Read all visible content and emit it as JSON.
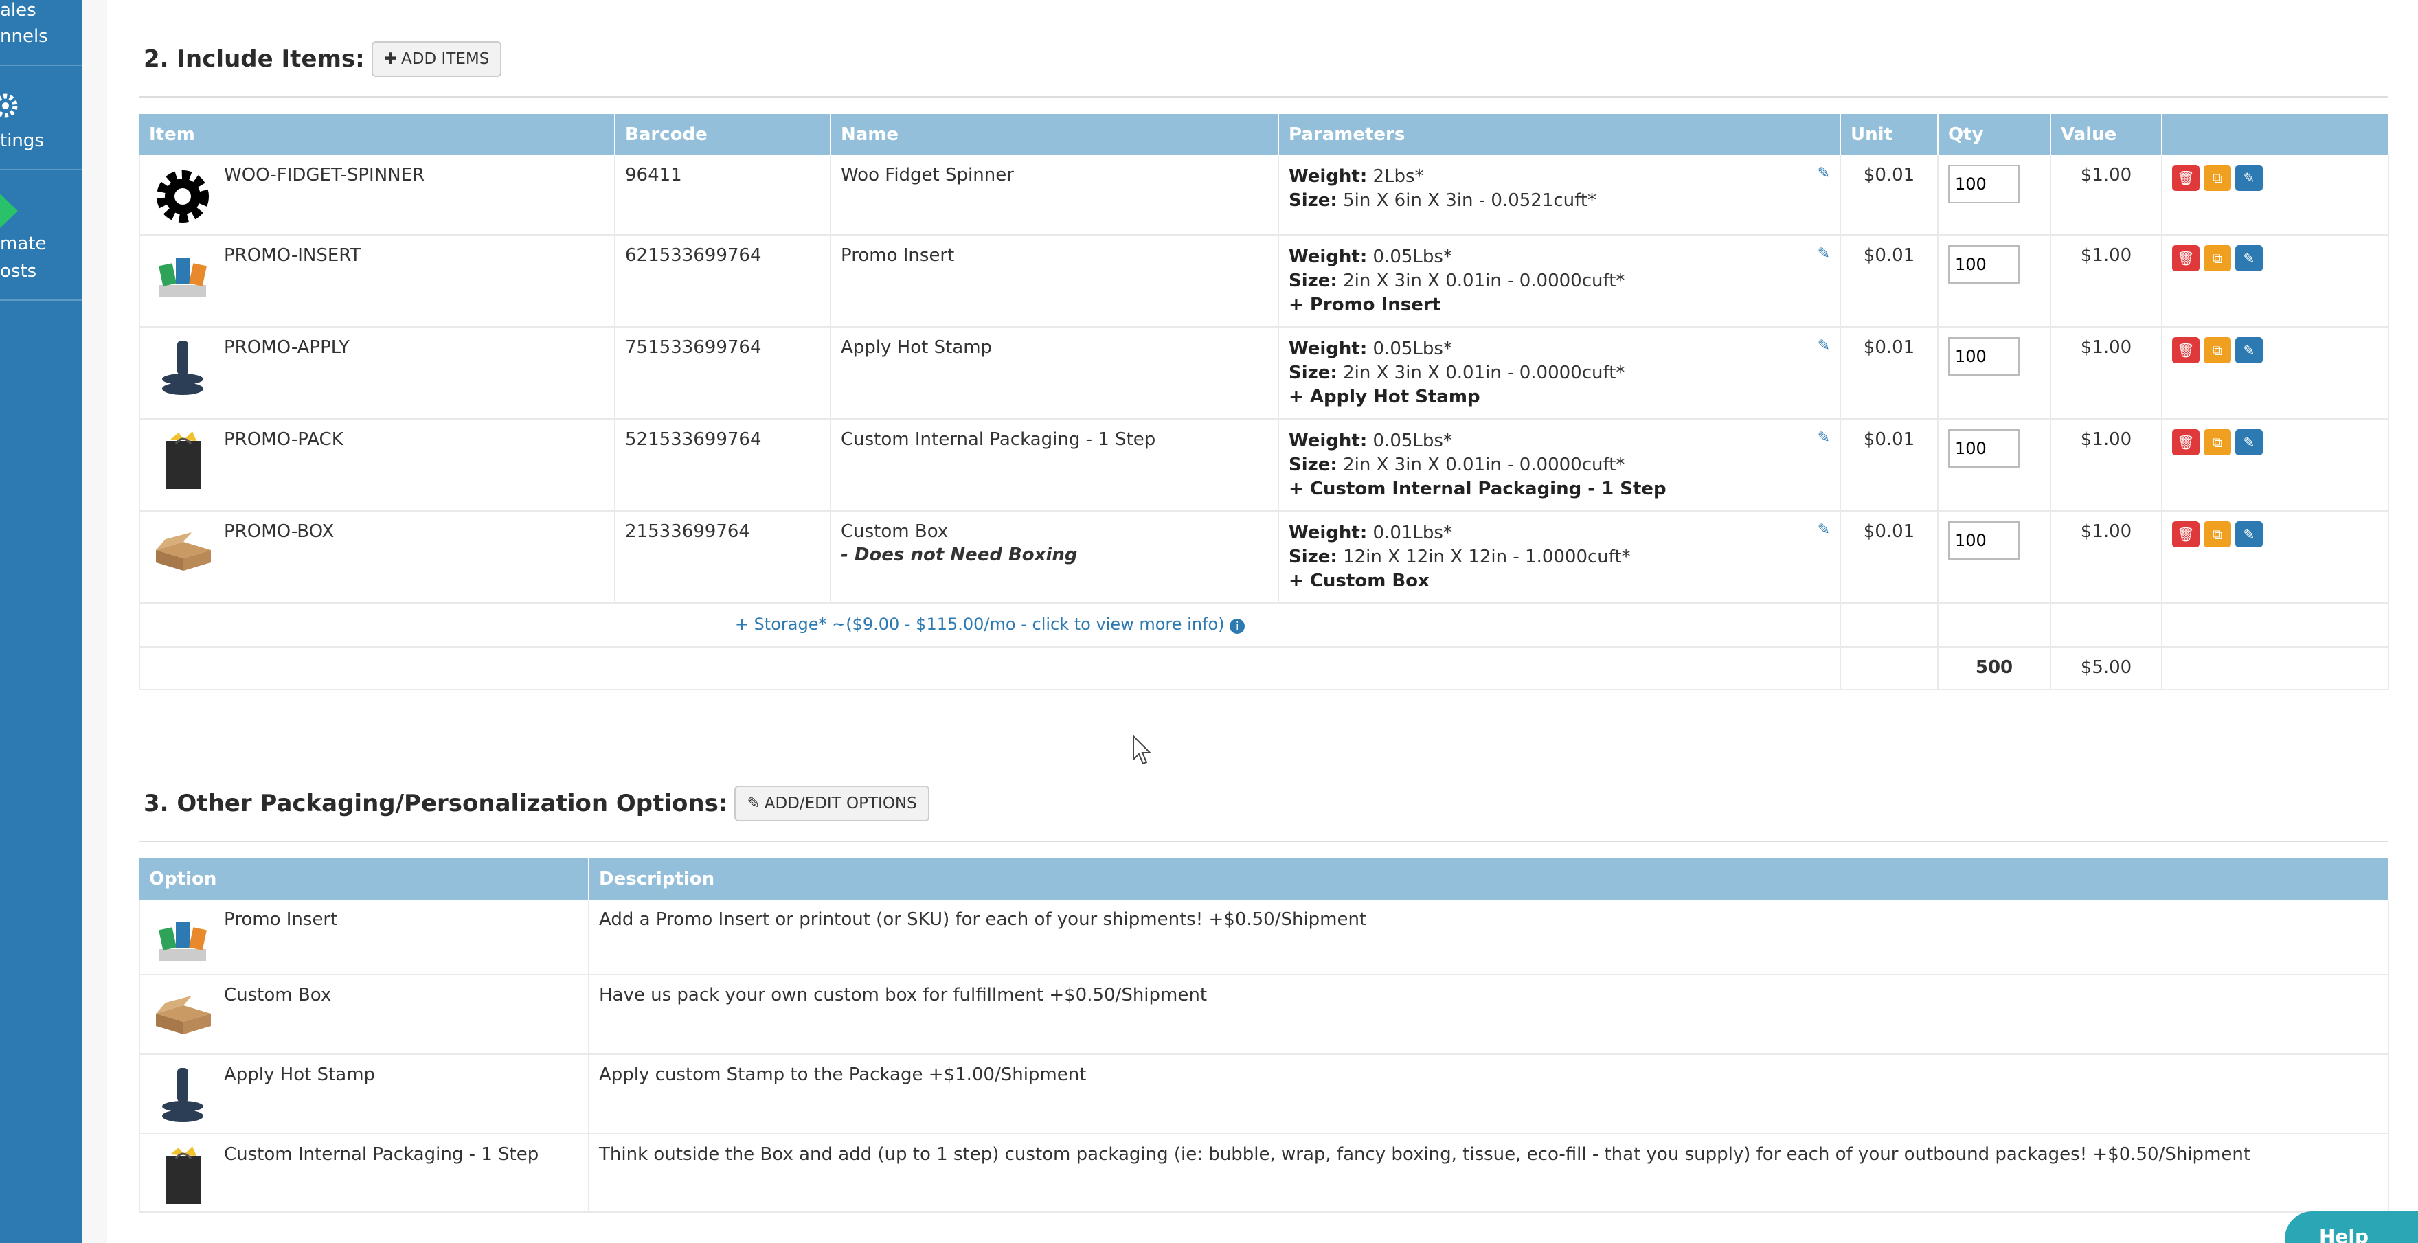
{
  "sidebar": {
    "items": [
      {
        "label": "ales"
      },
      {
        "label": "nnels"
      },
      {
        "label": "tings"
      },
      {
        "label": "mate"
      },
      {
        "label": "osts"
      }
    ]
  },
  "include_items": {
    "title": "2. Include Items:",
    "add_button": "ADD ITEMS",
    "columns": [
      "Item",
      "Barcode",
      "Name",
      "Parameters",
      "Unit",
      "Qty",
      "Value",
      ""
    ],
    "rows": [
      {
        "sku": "WOO-FIDGET-SPINNER",
        "barcode": "96411",
        "name": "Woo Fidget Spinner",
        "name_note": "",
        "weight_label": "Weight:",
        "weight": "2Lbs*",
        "size_label": "Size:",
        "size": "5in X 6in X 3in - 0.0521cuft*",
        "extra": "",
        "unit": "$0.01",
        "qty": "100",
        "value": "$1.00",
        "thumb": "gear"
      },
      {
        "sku": "PROMO-INSERT",
        "barcode": "621533699764",
        "name": "Promo Insert",
        "name_note": "",
        "weight_label": "Weight:",
        "weight": "0.05Lbs*",
        "size_label": "Size:",
        "size": "2in X 3in X 0.01in - 0.0000cuft*",
        "extra": "+ Promo Insert",
        "unit": "$0.01",
        "qty": "100",
        "value": "$1.00",
        "thumb": "cards"
      },
      {
        "sku": "PROMO-APPLY",
        "barcode": "751533699764",
        "name": "Apply Hot Stamp",
        "name_note": "",
        "weight_label": "Weight:",
        "weight": "0.05Lbs*",
        "size_label": "Size:",
        "size": "2in X 3in X 0.01in - 0.0000cuft*",
        "extra": "+ Apply Hot Stamp",
        "unit": "$0.01",
        "qty": "100",
        "value": "$1.00",
        "thumb": "stamp"
      },
      {
        "sku": "PROMO-PACK",
        "barcode": "521533699764",
        "name": "Custom Internal Packaging - 1 Step",
        "name_note": "",
        "weight_label": "Weight:",
        "weight": "0.05Lbs*",
        "size_label": "Size:",
        "size": "2in X 3in X 0.01in - 0.0000cuft*",
        "extra": "+ Custom Internal Packaging - 1 Step",
        "unit": "$0.01",
        "qty": "100",
        "value": "$1.00",
        "thumb": "bag"
      },
      {
        "sku": "PROMO-BOX",
        "barcode": "21533699764",
        "name": "Custom Box",
        "name_note": "- Does not Need Boxing",
        "weight_label": "Weight:",
        "weight": "0.01Lbs*",
        "size_label": "Size:",
        "size": "12in X 12in X 12in - 1.0000cuft*",
        "extra": "+ Custom Box",
        "unit": "$0.01",
        "qty": "100",
        "value": "$1.00",
        "thumb": "box"
      }
    ],
    "storage_text": "+ Storage* ~($9.00 - $115.00/mo - click to view more info)",
    "total_qty": "500",
    "total_value": "$5.00"
  },
  "options": {
    "title": "3. Other Packaging/Personalization Options:",
    "edit_button": "ADD/EDIT OPTIONS",
    "columns": [
      "Option",
      "Description"
    ],
    "rows": [
      {
        "option": "Promo Insert",
        "description": "Add a Promo Insert or printout (or SKU) for each of your shipments! +$0.50/Shipment",
        "thumb": "cards"
      },
      {
        "option": "Custom Box",
        "description": "Have us pack your own custom box for fulfillment +$0.50/Shipment",
        "thumb": "box"
      },
      {
        "option": "Apply Hot Stamp",
        "description": "Apply custom Stamp to the Package +$1.00/Shipment",
        "thumb": "stamp"
      },
      {
        "option": "Custom Internal Packaging - 1 Step",
        "description": "Think outside the Box and add (up to 1 step) custom packaging (ie: bubble, wrap, fancy boxing, tissue, eco-fill - that you supply) for each of your outbound packages! +$0.50/Shipment",
        "thumb": "bag"
      }
    ]
  },
  "help": {
    "label": "Help"
  },
  "colors": {
    "sidebar": "#2c7ab1",
    "table_header": "#93bfda",
    "danger": "#e0393b",
    "warning": "#f0a020",
    "primary": "#2c7ab1"
  }
}
